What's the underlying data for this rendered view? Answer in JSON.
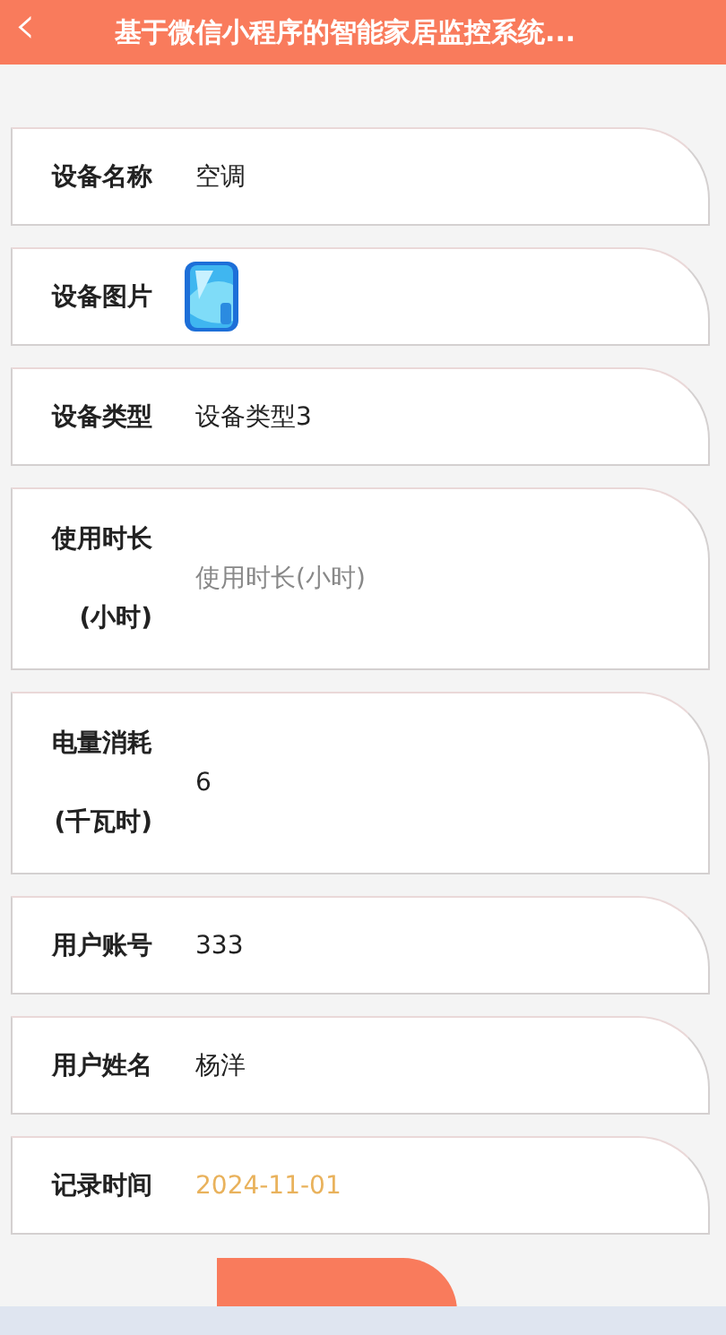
{
  "header": {
    "back_icon": "‹",
    "title": "基于微信小程序的智能家居监控系统..."
  },
  "fields": [
    {
      "kind": "text",
      "label": "设备名称",
      "value": "空调"
    },
    {
      "kind": "picture",
      "label": "设备图片"
    },
    {
      "kind": "text",
      "label": "设备类型",
      "value": "设备类型3"
    },
    {
      "kind": "input",
      "label": "使用时长(小时)",
      "placeholder": "使用时长(小时)"
    },
    {
      "kind": "text",
      "label": "电量消耗(千瓦时)",
      "value": "6"
    },
    {
      "kind": "text",
      "label": "用户账号",
      "value": "333"
    },
    {
      "kind": "text",
      "label": "用户姓名",
      "value": "杨洋"
    },
    {
      "kind": "date",
      "label": "记录时间",
      "value": "2024-11-01"
    }
  ]
}
